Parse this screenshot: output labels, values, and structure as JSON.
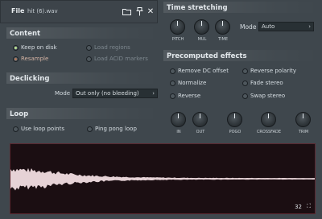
{
  "file": {
    "label": "File",
    "name": "hit (6).wav"
  },
  "content": {
    "title": "Content",
    "keep_on_disk": "Keep on disk",
    "resample": "Resample",
    "load_regions": "Load regions",
    "load_acid": "Load ACID markers"
  },
  "declicking": {
    "title": "Declicking",
    "mode_label": "Mode",
    "mode_value": "Out only (no bleeding)"
  },
  "loop": {
    "title": "Loop",
    "use_loop_points": "Use loop points",
    "ping_pong": "Ping pong loop"
  },
  "time_stretching": {
    "title": "Time stretching",
    "knobs": [
      "PITCH",
      "MUL",
      "TIME"
    ],
    "mode_label": "Mode",
    "mode_value": "Auto"
  },
  "precomputed": {
    "title": "Precomputed effects",
    "remove_dc": "Remove DC offset",
    "reverse_polarity": "Reverse polarity",
    "normalize": "Normalize",
    "fade_stereo": "Fade stereo",
    "reverse": "Reverse",
    "swap_stereo": "Swap stereo",
    "knobs": [
      "IN",
      "OUT",
      "POGO",
      "CROSSFADE",
      "TRIM"
    ]
  },
  "waveform": {
    "zoom": "32"
  },
  "colors": {
    "accent_green": "#b9e38f",
    "wave": "#e6d2d6",
    "wave_bg": "#1b0e12"
  }
}
